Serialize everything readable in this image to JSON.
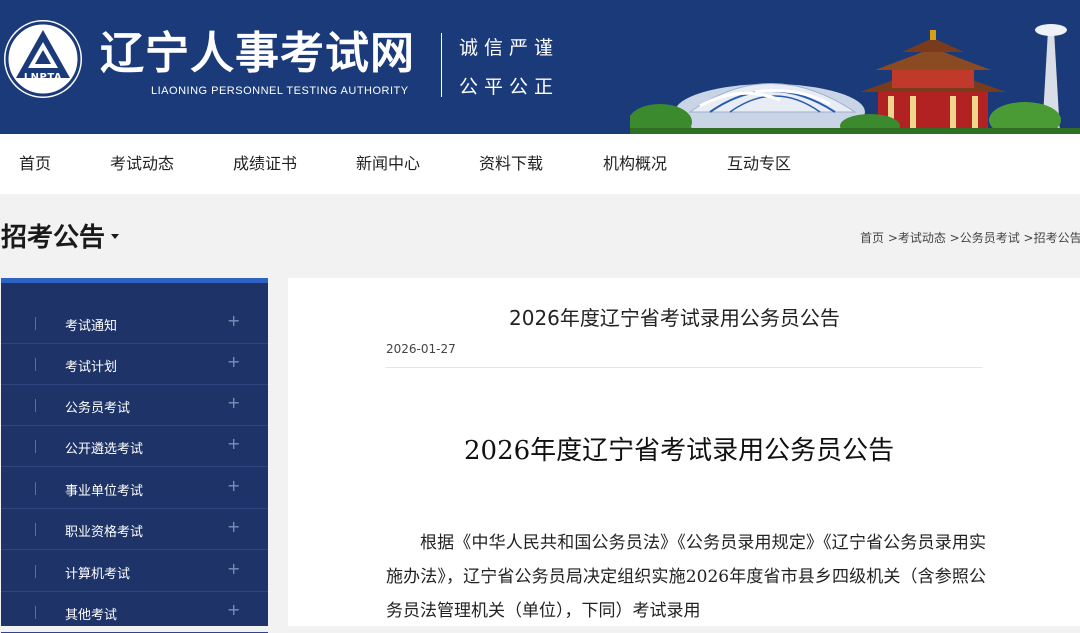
{
  "header": {
    "logo_text": "LNPTA",
    "title": "辽宁人事考试网",
    "subtitle": "LIAONING PERSONNEL TESTING AUTHORITY",
    "motto_line1": "诚信严谨",
    "motto_line2": "公平公正"
  },
  "nav": {
    "items": [
      "首页",
      "考试动态",
      "成绩证书",
      "新闻中心",
      "资料下载",
      "机构概况",
      "互动专区"
    ]
  },
  "section": {
    "title": "招考公告",
    "breadcrumb": "首页 >考试动态 >公务员考试 >招考公告"
  },
  "sidebar": {
    "items": [
      {
        "label": "考试通知",
        "icon": "plus-icon"
      },
      {
        "label": "考试计划",
        "icon": "plus-icon"
      },
      {
        "label": "公务员考试",
        "icon": "plus-icon"
      },
      {
        "label": "公开遴选考试",
        "icon": "plus-icon"
      },
      {
        "label": "事业单位考试",
        "icon": "plus-icon"
      },
      {
        "label": "职业资格考试",
        "icon": "plus-icon"
      },
      {
        "label": "计算机考试",
        "icon": "plus-icon"
      },
      {
        "label": "其他考试",
        "icon": "plus-icon"
      }
    ],
    "plus_glyph": "+"
  },
  "article": {
    "title": "2026年度辽宁省考试录用公务员公告",
    "date": "2026-01-27",
    "doc_title": "2026年度辽宁省考试录用公务员公告",
    "paragraph": "根据《中华人民共和国公务员法》《公务员录用规定》《辽宁省公务员录用实施办法》，辽宁省公务员局决定组织实施2026年度省市县乡四级机关（含参照公务员法管理机关（单位），下同）考试录用"
  },
  "colors": {
    "header_bg": "#1a3a7a",
    "sidebar_bg": "#1e3368",
    "sidebar_accent": "#2c63c4"
  }
}
